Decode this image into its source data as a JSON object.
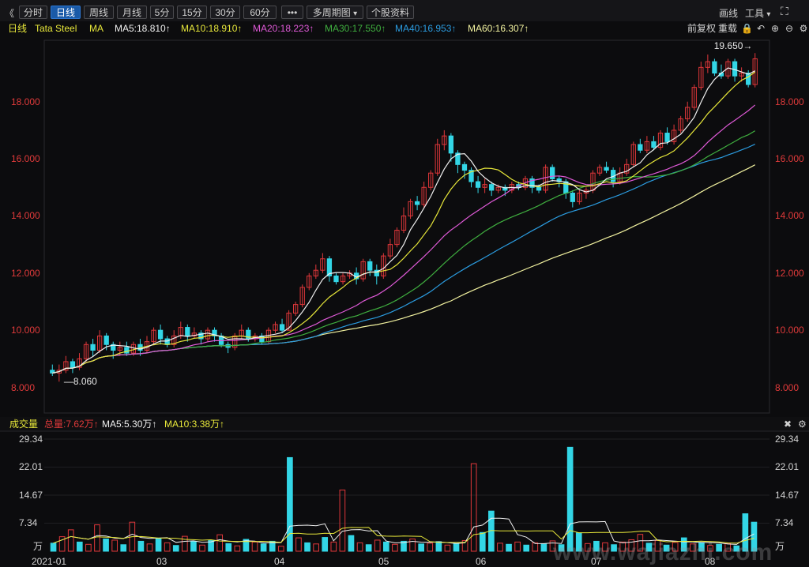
{
  "toolbar": {
    "back": "《",
    "periods": [
      "分时",
      "日线",
      "周线",
      "月线",
      "5分",
      "15分",
      "30分",
      "60分"
    ],
    "active_period": "日线",
    "more": "•••",
    "multi_period": "多周期图",
    "stock_info": "个股资料",
    "draw": "画线",
    "tools": "工具",
    "tools_caret": "▾",
    "fullscreen": "⛶"
  },
  "ma_row": {
    "period": "日线",
    "symbol": "Tata Steel",
    "ma": "MA",
    "ma5": "MA5:18.810↑",
    "ma10": "MA10:18.910↑",
    "ma20": "MA20:18.223↑",
    "ma30": "MA30:17.550↑",
    "ma40": "MA40:16.953↑",
    "ma60": "MA60:16.307↑",
    "adjust": "前复权",
    "overlay": "重载"
  },
  "volume_header": {
    "title": "成交量",
    "total": "总量:7.62万↑",
    "ma5": "MA5:5.30万↑",
    "ma10": "MA10:3.38万↑"
  },
  "colors": {
    "up": "#e0373a",
    "down": "#33d6e6",
    "ma5": "#f0f0f0",
    "ma10": "#e8e83a",
    "ma20": "#e05ad8",
    "ma30": "#3fae3f",
    "ma40": "#2b9ce0",
    "ma60": "#f3f3a0"
  },
  "chart_data": {
    "type": "candlestick",
    "title": "Tata Steel",
    "price_ticks": [
      "8.000",
      "10.000",
      "12.000",
      "14.000",
      "16.000",
      "18.000"
    ],
    "ylim": [
      7.6,
      19.9
    ],
    "x_labels": [
      "2021-01",
      "03",
      "04",
      "05",
      "06",
      "07",
      "08"
    ],
    "annotations": {
      "high": "19.650",
      "low": "8.060"
    },
    "candles": [
      [
        8.6,
        8.5,
        8.8,
        8.4
      ],
      [
        8.5,
        8.6,
        8.8,
        8.2
      ],
      [
        8.6,
        8.9,
        9.1,
        8.5
      ],
      [
        8.9,
        8.7,
        9.0,
        8.5
      ],
      [
        8.7,
        9.0,
        9.2,
        8.6
      ],
      [
        9.0,
        9.5,
        9.6,
        8.9
      ],
      [
        9.5,
        9.3,
        9.7,
        9.1
      ],
      [
        9.3,
        9.8,
        10.0,
        9.2
      ],
      [
        9.8,
        9.5,
        9.9,
        9.3
      ],
      [
        9.5,
        9.3,
        9.6,
        9.0
      ],
      [
        9.3,
        9.4,
        9.6,
        9.1
      ],
      [
        9.4,
        9.2,
        9.6,
        9.1
      ],
      [
        9.2,
        9.5,
        9.6,
        9.1
      ],
      [
        9.5,
        9.3,
        9.7,
        9.1
      ],
      [
        9.3,
        9.6,
        9.8,
        9.2
      ],
      [
        9.6,
        10.0,
        10.1,
        9.5
      ],
      [
        10.0,
        9.7,
        10.2,
        9.5
      ],
      [
        9.7,
        9.5,
        9.8,
        9.4
      ],
      [
        9.5,
        9.8,
        10.0,
        9.4
      ],
      [
        9.8,
        10.1,
        10.3,
        9.7
      ],
      [
        10.1,
        9.8,
        10.2,
        9.6
      ],
      [
        9.8,
        9.9,
        10.1,
        9.7
      ],
      [
        9.9,
        9.7,
        10.0,
        9.5
      ],
      [
        9.7,
        10.0,
        10.1,
        9.6
      ],
      [
        10.0,
        9.8,
        10.1,
        9.6
      ],
      [
        9.8,
        9.5,
        9.9,
        9.4
      ],
      [
        9.5,
        9.4,
        9.6,
        9.2
      ],
      [
        9.4,
        9.8,
        9.9,
        9.3
      ],
      [
        9.8,
        10.0,
        10.2,
        9.7
      ],
      [
        10.0,
        9.7,
        10.1,
        9.6
      ],
      [
        9.7,
        9.8,
        9.9,
        9.6
      ],
      [
        9.8,
        9.6,
        9.9,
        9.5
      ],
      [
        9.6,
        10.0,
        10.1,
        9.5
      ],
      [
        10.0,
        10.2,
        10.3,
        9.9
      ],
      [
        10.2,
        10.0,
        10.4,
        9.9
      ],
      [
        10.0,
        10.6,
        10.7,
        10.0
      ],
      [
        10.6,
        10.9,
        11.0,
        10.5
      ],
      [
        10.9,
        11.5,
        11.6,
        10.8
      ],
      [
        11.5,
        11.9,
        12.0,
        11.4
      ],
      [
        11.9,
        12.1,
        12.3,
        11.8
      ],
      [
        12.1,
        12.5,
        12.7,
        12.0
      ],
      [
        12.5,
        11.9,
        12.6,
        11.7
      ],
      [
        11.9,
        11.7,
        12.0,
        11.6
      ],
      [
        11.7,
        11.9,
        12.0,
        11.6
      ],
      [
        11.9,
        12.0,
        12.1,
        11.8
      ],
      [
        12.0,
        11.8,
        12.2,
        11.6
      ],
      [
        11.8,
        12.4,
        12.5,
        11.7
      ],
      [
        12.4,
        12.1,
        12.5,
        11.9
      ],
      [
        12.1,
        11.9,
        12.3,
        11.6
      ],
      [
        11.9,
        12.6,
        12.7,
        11.8
      ],
      [
        12.6,
        13.0,
        13.2,
        12.5
      ],
      [
        13.0,
        13.5,
        13.6,
        12.9
      ],
      [
        13.5,
        14.0,
        14.3,
        13.4
      ],
      [
        14.0,
        14.5,
        14.6,
        13.9
      ],
      [
        14.5,
        14.4,
        14.7,
        14.2
      ],
      [
        14.4,
        15.0,
        15.2,
        14.3
      ],
      [
        15.0,
        15.5,
        15.6,
        14.9
      ],
      [
        15.5,
        16.5,
        16.7,
        15.4
      ],
      [
        16.5,
        16.8,
        17.0,
        16.3
      ],
      [
        16.8,
        16.2,
        16.9,
        15.9
      ],
      [
        16.2,
        15.8,
        16.3,
        15.5
      ],
      [
        15.8,
        15.6,
        15.9,
        15.3
      ],
      [
        15.6,
        15.2,
        15.7,
        15.0
      ],
      [
        15.2,
        15.0,
        15.4,
        14.8
      ],
      [
        15.0,
        15.1,
        15.3,
        14.8
      ],
      [
        15.1,
        14.9,
        15.2,
        14.7
      ],
      [
        14.9,
        15.0,
        15.1,
        14.8
      ],
      [
        15.0,
        14.9,
        15.1,
        14.7
      ],
      [
        14.9,
        15.1,
        15.2,
        14.8
      ],
      [
        15.1,
        15.0,
        15.2,
        14.9
      ],
      [
        15.0,
        15.3,
        15.4,
        14.9
      ],
      [
        15.3,
        15.0,
        15.4,
        14.8
      ],
      [
        15.0,
        14.9,
        15.1,
        14.8
      ],
      [
        14.9,
        15.7,
        15.8,
        14.8
      ],
      [
        15.7,
        15.3,
        15.8,
        15.2
      ],
      [
        15.3,
        15.2,
        15.4,
        15.0
      ],
      [
        15.2,
        14.8,
        15.3,
        14.6
      ],
      [
        14.8,
        14.5,
        14.9,
        14.3
      ],
      [
        14.5,
        14.8,
        14.9,
        14.4
      ],
      [
        14.8,
        14.9,
        15.0,
        14.6
      ],
      [
        14.9,
        15.5,
        15.6,
        14.8
      ],
      [
        15.5,
        15.7,
        15.8,
        15.4
      ],
      [
        15.7,
        15.6,
        15.9,
        15.5
      ],
      [
        15.6,
        15.2,
        15.7,
        15.0
      ],
      [
        15.2,
        15.5,
        15.7,
        15.1
      ],
      [
        15.5,
        15.8,
        16.0,
        15.4
      ],
      [
        15.8,
        16.5,
        16.6,
        15.7
      ],
      [
        16.5,
        16.3,
        16.7,
        16.2
      ],
      [
        16.3,
        16.6,
        16.8,
        16.2
      ],
      [
        16.6,
        16.4,
        16.8,
        16.3
      ],
      [
        16.4,
        16.9,
        17.0,
        16.3
      ],
      [
        16.9,
        16.6,
        17.1,
        16.5
      ],
      [
        16.6,
        17.0,
        17.2,
        16.5
      ],
      [
        17.0,
        17.4,
        17.5,
        16.9
      ],
      [
        17.4,
        17.8,
        18.0,
        17.3
      ],
      [
        17.8,
        18.5,
        18.6,
        17.7
      ],
      [
        18.5,
        19.2,
        19.4,
        18.4
      ],
      [
        19.2,
        19.4,
        19.65,
        19.0
      ],
      [
        19.4,
        19.0,
        19.5,
        18.9
      ],
      [
        19.0,
        18.9,
        19.3,
        18.8
      ],
      [
        18.9,
        19.4,
        19.5,
        18.8
      ],
      [
        19.4,
        18.9,
        19.5,
        18.7
      ],
      [
        18.9,
        19.0,
        19.2,
        18.7
      ],
      [
        19.0,
        18.6,
        19.1,
        18.5
      ],
      [
        18.6,
        19.5,
        19.7,
        18.5
      ]
    ],
    "ma_lines": [
      {
        "name": "MA5",
        "start": 8.7,
        "end": 18.81
      },
      {
        "name": "MA10",
        "start": 8.8,
        "end": 18.91
      },
      {
        "name": "MA20",
        "start": 9.15,
        "end": 18.223
      },
      {
        "name": "MA30",
        "start": 8.7,
        "end": 17.55
      },
      {
        "name": "MA40",
        "start": 8.5,
        "end": 16.953
      },
      {
        "name": "MA60",
        "start": 8.0,
        "end": 16.307
      }
    ],
    "volume_ticks": [
      "29.34",
      "22.01",
      "14.67",
      "7.34",
      "万"
    ],
    "volume_ylim": [
      0,
      29.34
    ],
    "volumes": [
      [
        2.1,
        0
      ],
      [
        3.8,
        1
      ],
      [
        5.6,
        1
      ],
      [
        2.4,
        0
      ],
      [
        1.8,
        1
      ],
      [
        6.9,
        1
      ],
      [
        3.2,
        0
      ],
      [
        2.9,
        1
      ],
      [
        1.7,
        0
      ],
      [
        7.6,
        1
      ],
      [
        2.6,
        0
      ],
      [
        1.9,
        1
      ],
      [
        3.4,
        0
      ],
      [
        2.2,
        1
      ],
      [
        1.5,
        0
      ],
      [
        3.9,
        1
      ],
      [
        2.5,
        0
      ],
      [
        1.6,
        1
      ],
      [
        2.8,
        0
      ],
      [
        4.3,
        1
      ],
      [
        2.0,
        0
      ],
      [
        1.4,
        1
      ],
      [
        3.1,
        0
      ],
      [
        2.4,
        1
      ],
      [
        1.9,
        0
      ],
      [
        2.6,
        0
      ],
      [
        1.3,
        1
      ],
      [
        24.5,
        0
      ],
      [
        3.5,
        1
      ],
      [
        2.2,
        0
      ],
      [
        1.9,
        1
      ],
      [
        3.6,
        0
      ],
      [
        2.4,
        1
      ],
      [
        16.0,
        1
      ],
      [
        4.1,
        0
      ],
      [
        2.2,
        1
      ],
      [
        1.7,
        0
      ],
      [
        2.9,
        1
      ],
      [
        2.4,
        0
      ],
      [
        1.8,
        1
      ],
      [
        2.6,
        0
      ],
      [
        3.2,
        1
      ],
      [
        1.9,
        0
      ],
      [
        2.1,
        1
      ],
      [
        2.5,
        0
      ],
      [
        1.6,
        1
      ],
      [
        2.0,
        0
      ],
      [
        2.8,
        1
      ],
      [
        22.9,
        1
      ],
      [
        4.9,
        0
      ],
      [
        10.5,
        0
      ],
      [
        2.1,
        1
      ],
      [
        1.8,
        0
      ],
      [
        2.4,
        1
      ],
      [
        1.6,
        0
      ],
      [
        2.2,
        1
      ],
      [
        1.9,
        0
      ],
      [
        2.7,
        1
      ],
      [
        1.7,
        0
      ],
      [
        27.2,
        0
      ],
      [
        4.8,
        0
      ],
      [
        2.0,
        1
      ],
      [
        2.6,
        0
      ],
      [
        2.2,
        1
      ],
      [
        1.7,
        0
      ],
      [
        2.4,
        1
      ],
      [
        3.0,
        1
      ],
      [
        4.4,
        1
      ],
      [
        2.1,
        0
      ],
      [
        2.8,
        1
      ],
      [
        1.6,
        0
      ],
      [
        2.3,
        1
      ],
      [
        3.5,
        0
      ],
      [
        1.9,
        1
      ],
      [
        2.2,
        0
      ],
      [
        1.5,
        1
      ],
      [
        1.8,
        0
      ],
      [
        2.0,
        1
      ],
      [
        1.4,
        0
      ],
      [
        9.8,
        0
      ],
      [
        7.6,
        0
      ]
    ]
  }
}
